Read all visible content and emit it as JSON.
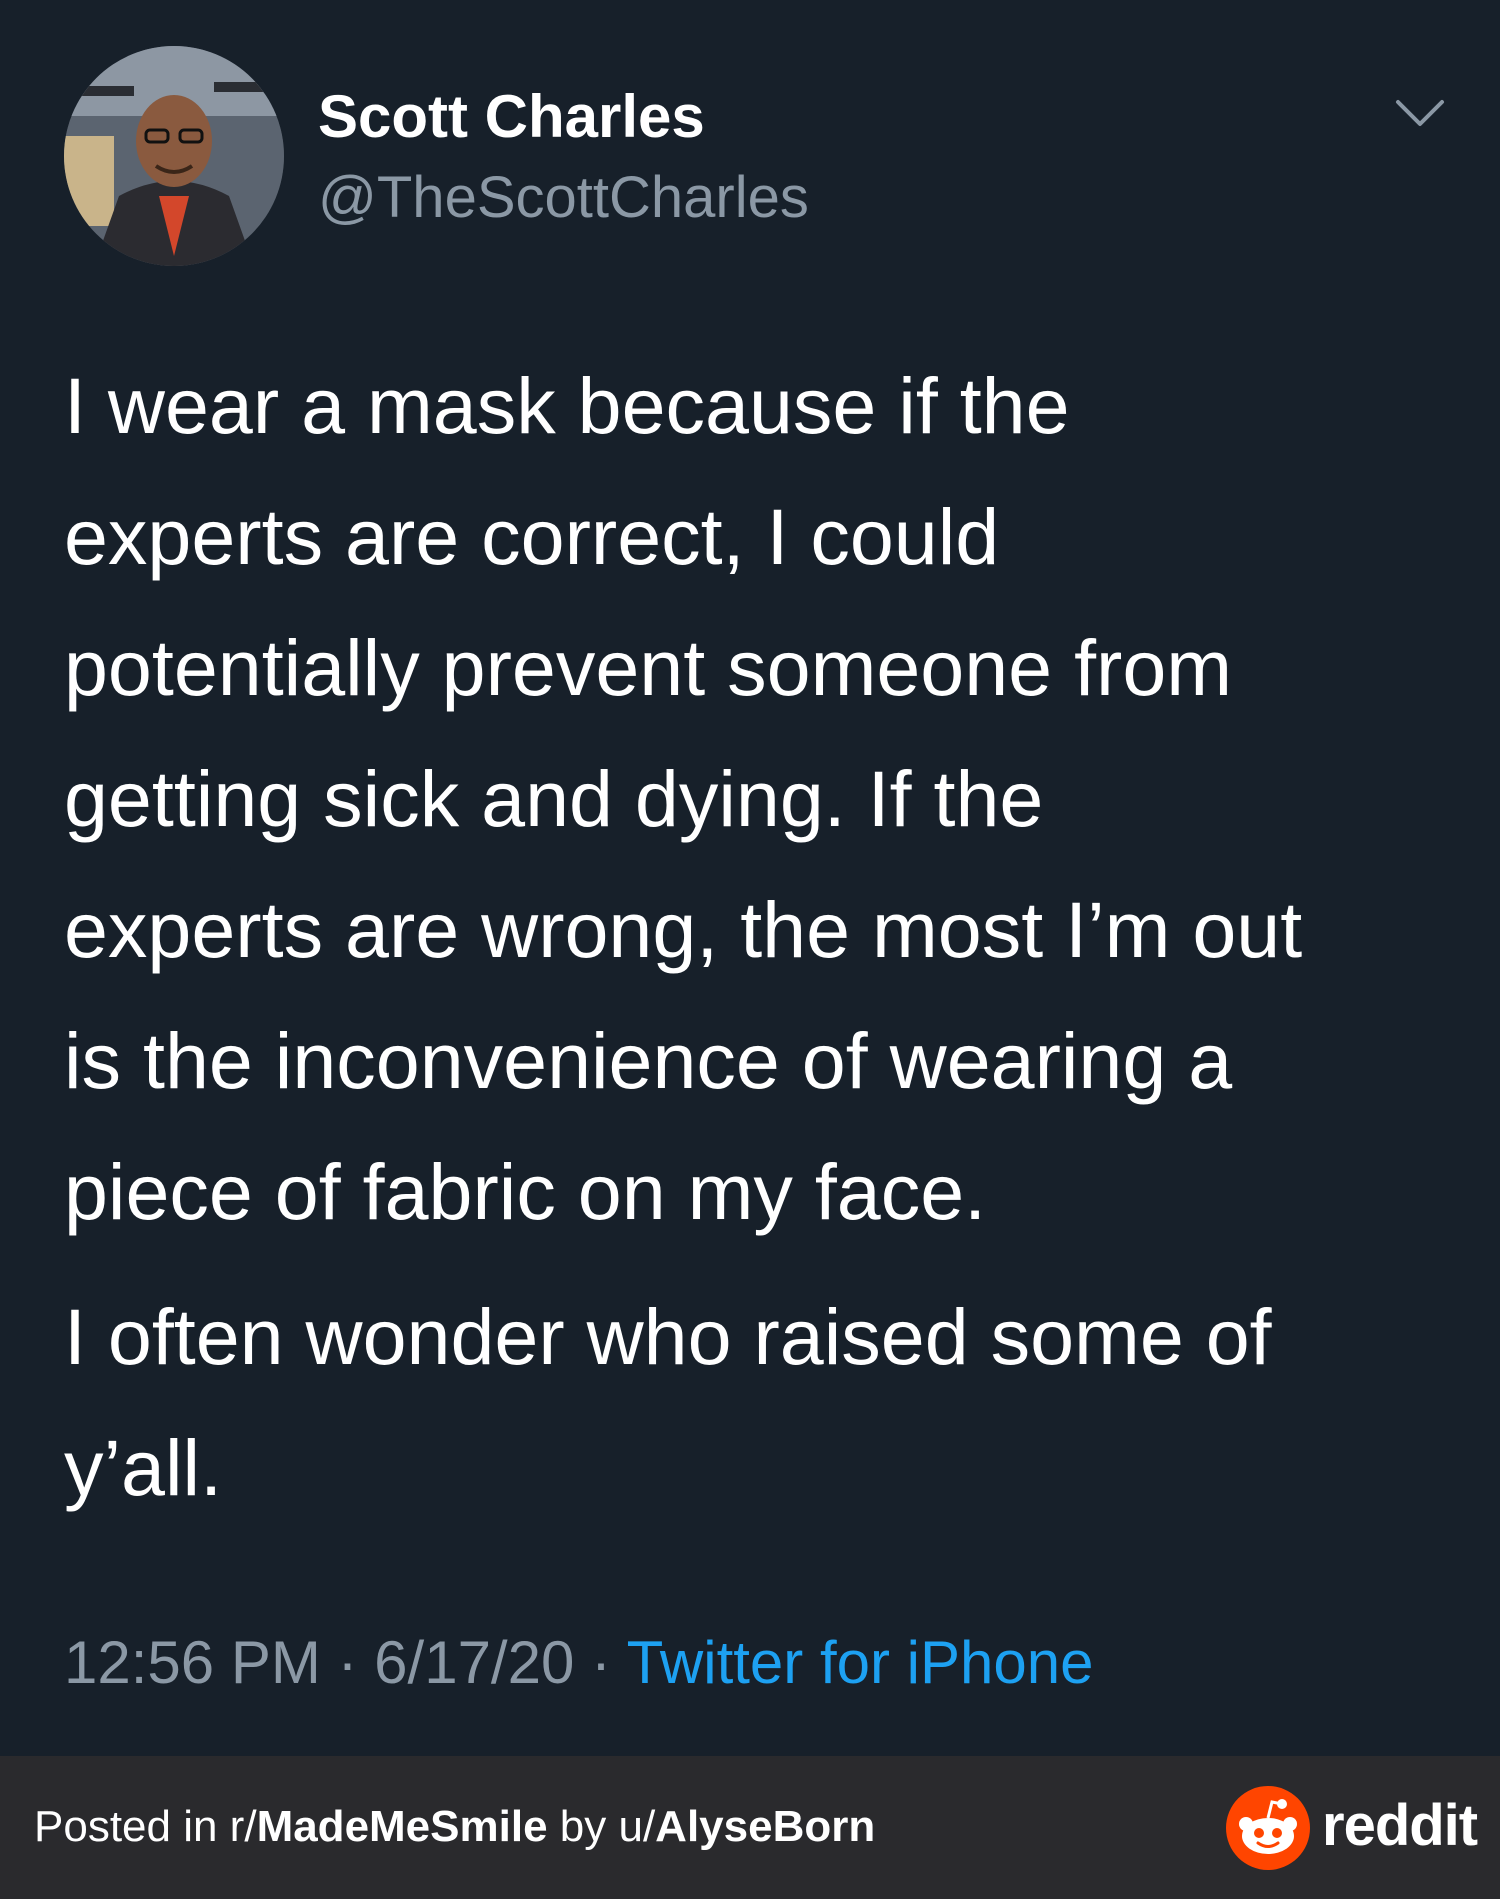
{
  "tweet": {
    "display_name": "Scott Charles",
    "handle": "@TheScottCharles",
    "avatar_icon": "user-avatar-photo",
    "menu_icon": "chevron-down-icon",
    "lines": [
      "I wear a mask because if the",
      "experts are correct, I could",
      "potentially prevent someone from",
      "getting sick and dying. If the",
      "experts are wrong, the most I’m out",
      "is the inconvenience of wearing a",
      "piece of fabric on my face."
    ],
    "lines2": [
      "I often wonder who raised some of",
      "y’all."
    ],
    "time": "12:56 PM",
    "separator": "·",
    "date": "6/17/20",
    "source": "Twitter for iPhone"
  },
  "footer": {
    "posted_in_prefix": "Posted in r/",
    "subreddit": "MadeMeSmile",
    "by_prefix": " by u/",
    "username": "AlyseBorn",
    "brand": "reddit",
    "brand_icon": "reddit-logo-icon"
  },
  "colors": {
    "background": "#17202a",
    "text": "#ffffff",
    "muted": "#8b98a5",
    "link": "#1da1f2",
    "footer_bg": "#2a2a2d",
    "reddit_orange": "#ff4500"
  }
}
